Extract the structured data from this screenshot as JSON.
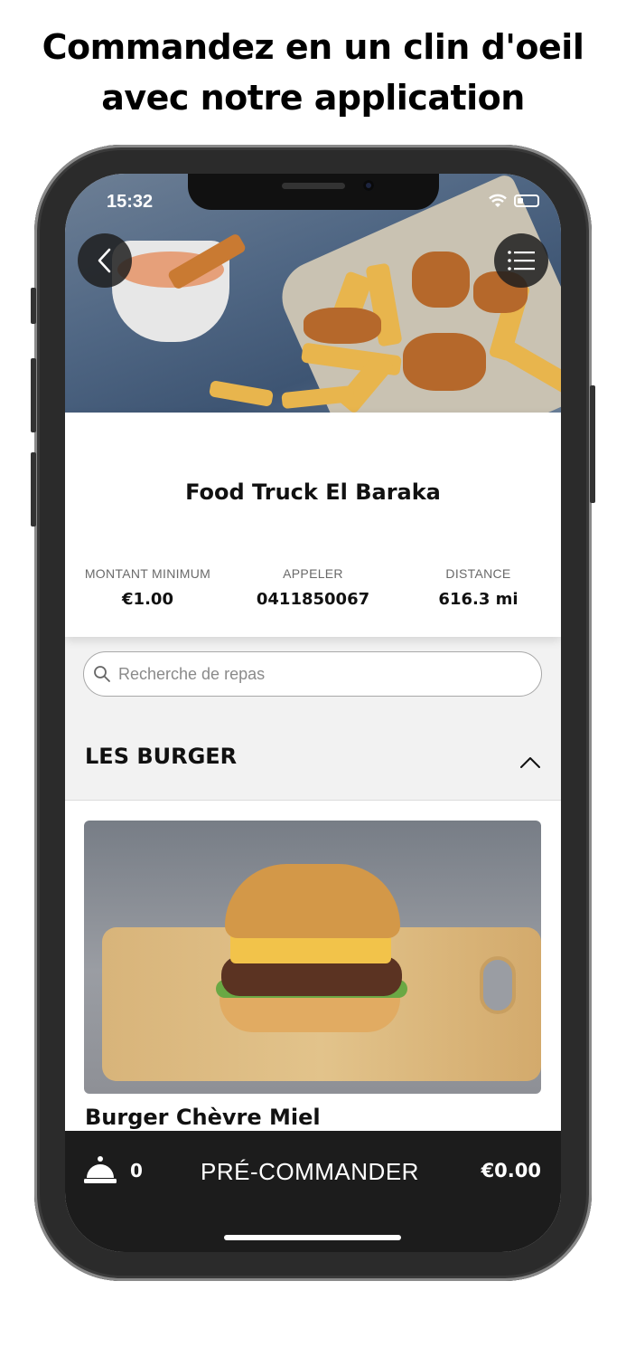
{
  "promo": {
    "line1": "Commandez en un clin d'oeil",
    "line2": "avec notre application"
  },
  "status_bar": {
    "time": "15:32"
  },
  "restaurant": {
    "name": "Food Truck El Baraka"
  },
  "stats": [
    {
      "label": "MONTANT MINIMUM",
      "value": "€1.00"
    },
    {
      "label": "APPELER",
      "value": "0411850067"
    },
    {
      "label": "DISTANCE",
      "value": "616.3 mi"
    }
  ],
  "search": {
    "placeholder": "Recherche de repas",
    "value": ""
  },
  "section": {
    "title": "LES BURGER"
  },
  "items": [
    {
      "name": "Burger Chèvre Miel"
    }
  ],
  "bottom_bar": {
    "count": "0",
    "action_label": "PRÉ-COMMANDER",
    "total": "€0.00"
  },
  "icons": {
    "back": "chevron-left-icon",
    "menu": "hamburger-menu-icon",
    "search": "search-icon",
    "collapse": "chevron-up-icon",
    "bell": "service-bell-icon"
  }
}
